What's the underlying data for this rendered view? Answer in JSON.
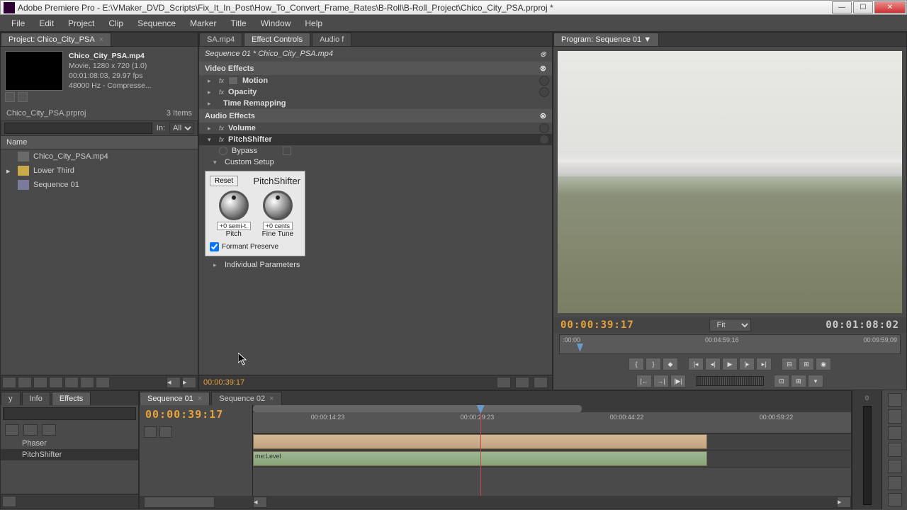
{
  "titlebar": {
    "app": "Adobe Premiere Pro",
    "path": "E:\\VMaker_DVD_Scripts\\Fix_It_In_Post\\How_To_Convert_Frame_Rates\\B-Roll\\B-Roll_Project\\Chico_City_PSA.prproj *"
  },
  "menu": [
    "File",
    "Edit",
    "Project",
    "Clip",
    "Sequence",
    "Marker",
    "Title",
    "Window",
    "Help"
  ],
  "project": {
    "tab": "Project: Chico_City_PSA",
    "clip_name": "Chico_City_PSA.mp4",
    "meta1": "Movie, 1280 x 720 (1.0)",
    "meta2": "00:01:08:03, 29.97 fps",
    "meta3": "48000 Hz - Compresse...",
    "bin": "Chico_City_PSA.prproj",
    "item_count": "3 Items",
    "in_label": "In:",
    "filter": "All",
    "col_name": "Name",
    "items": [
      {
        "name": "Chico_City_PSA.mp4",
        "type": "clip"
      },
      {
        "name": "Lower Third",
        "type": "folder"
      },
      {
        "name": "Sequence 01",
        "type": "seq"
      }
    ]
  },
  "effect_controls": {
    "tabs": {
      "left": "SA.mp4",
      "active": "Effect Controls",
      "right": "Audio f"
    },
    "header": "Sequence 01 * Chico_City_PSA.mp4",
    "video_effects": "Video Effects",
    "motion": "Motion",
    "opacity": "Opacity",
    "time_remap": "Time Remapping",
    "audio_effects": "Audio Effects",
    "volume": "Volume",
    "pitchshifter": "PitchShifter",
    "bypass": "Bypass",
    "custom_setup": "Custom Setup",
    "reset_btn": "Reset",
    "plugin_title": "PitchShifter",
    "pitch_val": "+0 semi-t.",
    "pitch_label": "Pitch",
    "fine_val": "+0 cents",
    "fine_label": "Fine Tune",
    "formant": "Formant Preserve",
    "individual": "Individual Parameters",
    "timecode": "00:00:39:17"
  },
  "program": {
    "tab": "Program: Sequence 01",
    "tc_left": "00:00:39:17",
    "fit": "Fit",
    "tc_right": "00:01:08:02",
    "ruler": {
      "start": ":00:00",
      "mid": "00:04:59;16",
      "end": "00:09:59;09"
    }
  },
  "effects_browser": {
    "tabs": {
      "a": "y",
      "b": "Info",
      "active": "Effects"
    },
    "items": [
      {
        "name": "Phaser",
        "sel": false
      },
      {
        "name": "PitchShifter",
        "sel": true
      }
    ]
  },
  "timeline": {
    "tabs": {
      "active": "Sequence 01",
      "other": "Sequence 02"
    },
    "tc": "00:00:39:17",
    "ruler": [
      "00:00:14:23",
      "00:00:29:23",
      "00:00:44:22",
      "00:00:59:22"
    ],
    "track_label": "me:Level"
  }
}
